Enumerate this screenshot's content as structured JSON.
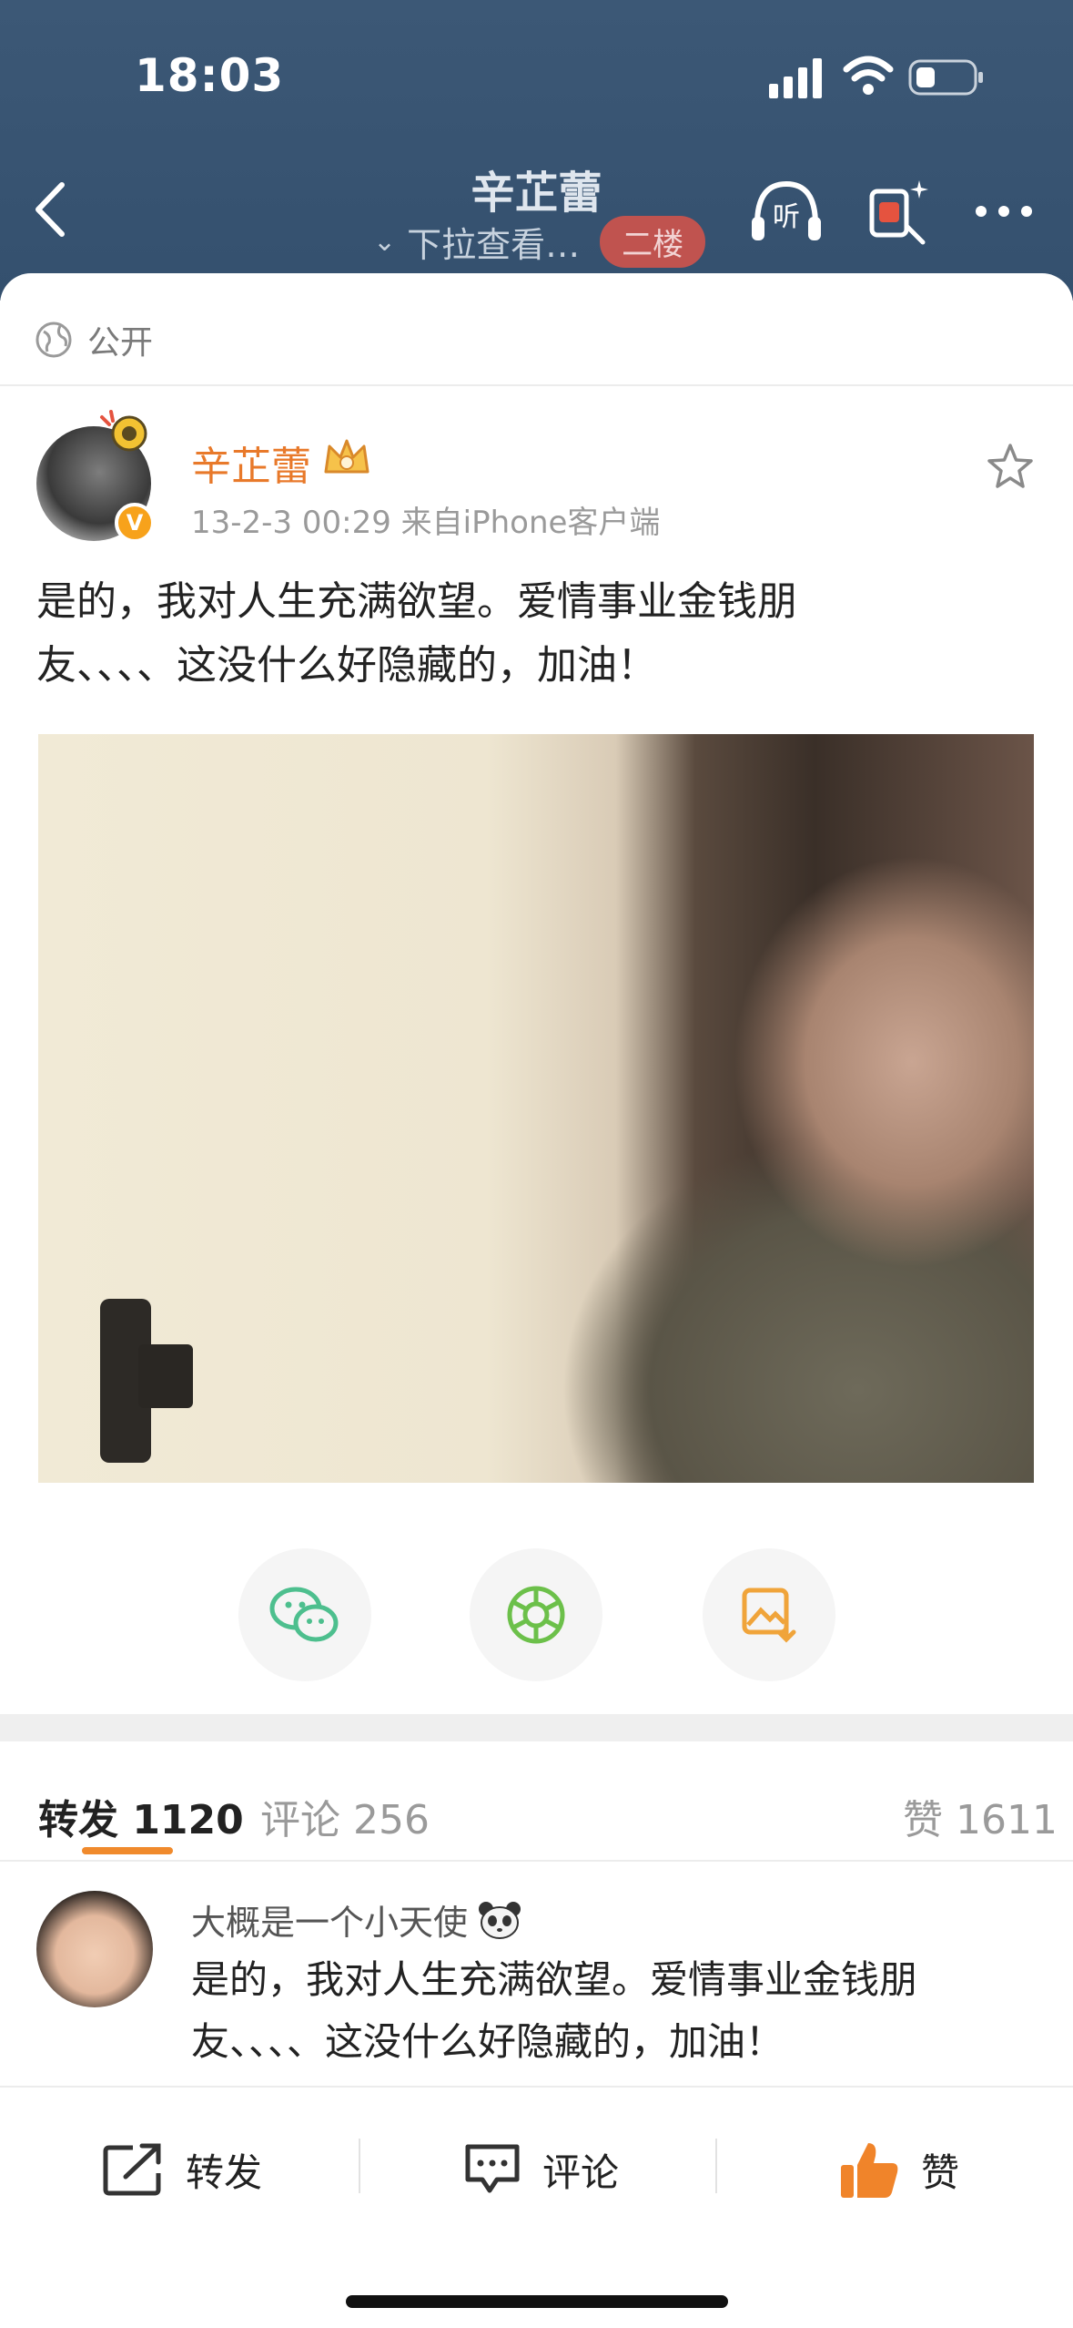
{
  "status_bar": {
    "time": "18:03"
  },
  "nav": {
    "title": "辛芷蕾",
    "subtitle": "下拉查看…",
    "floor_badge": "二楼",
    "listen_icon": "listen-icon",
    "red_packet_icon": "red-packet-icon",
    "more_icon": "more-icon"
  },
  "post": {
    "visibility_label": "公开",
    "author": "辛芷蕾",
    "verified_mark": "V",
    "meta": "13-2-3 00:29  来自iPhone客户端",
    "text_line1": "是的，我对人生充满欲望。爱情事业金钱朋",
    "text_line2": "友、、、、这没什么好隐藏的，加油！"
  },
  "share": {
    "wechat_icon": "wechat-icon",
    "moments_icon": "moments-icon",
    "save_image_icon": "save-image-icon"
  },
  "tabs": {
    "repost": "转发 1120",
    "comment": "评论 256",
    "like": "赞 1611"
  },
  "comment": {
    "user": "大概是一个小天使",
    "text_line1": "是的，我对人生充满欲望。爱情事业金钱朋",
    "text_line2": "友、、、、这没什么好隐藏的，加油！"
  },
  "bottom_bar": {
    "repost_label": "转发",
    "comment_label": "评论",
    "like_label": "赞"
  },
  "colors": {
    "header_bg": "#3c5876",
    "accent_orange": "#e8792a",
    "badge_red": "#c0534f",
    "like_orange": "#f0842a"
  }
}
